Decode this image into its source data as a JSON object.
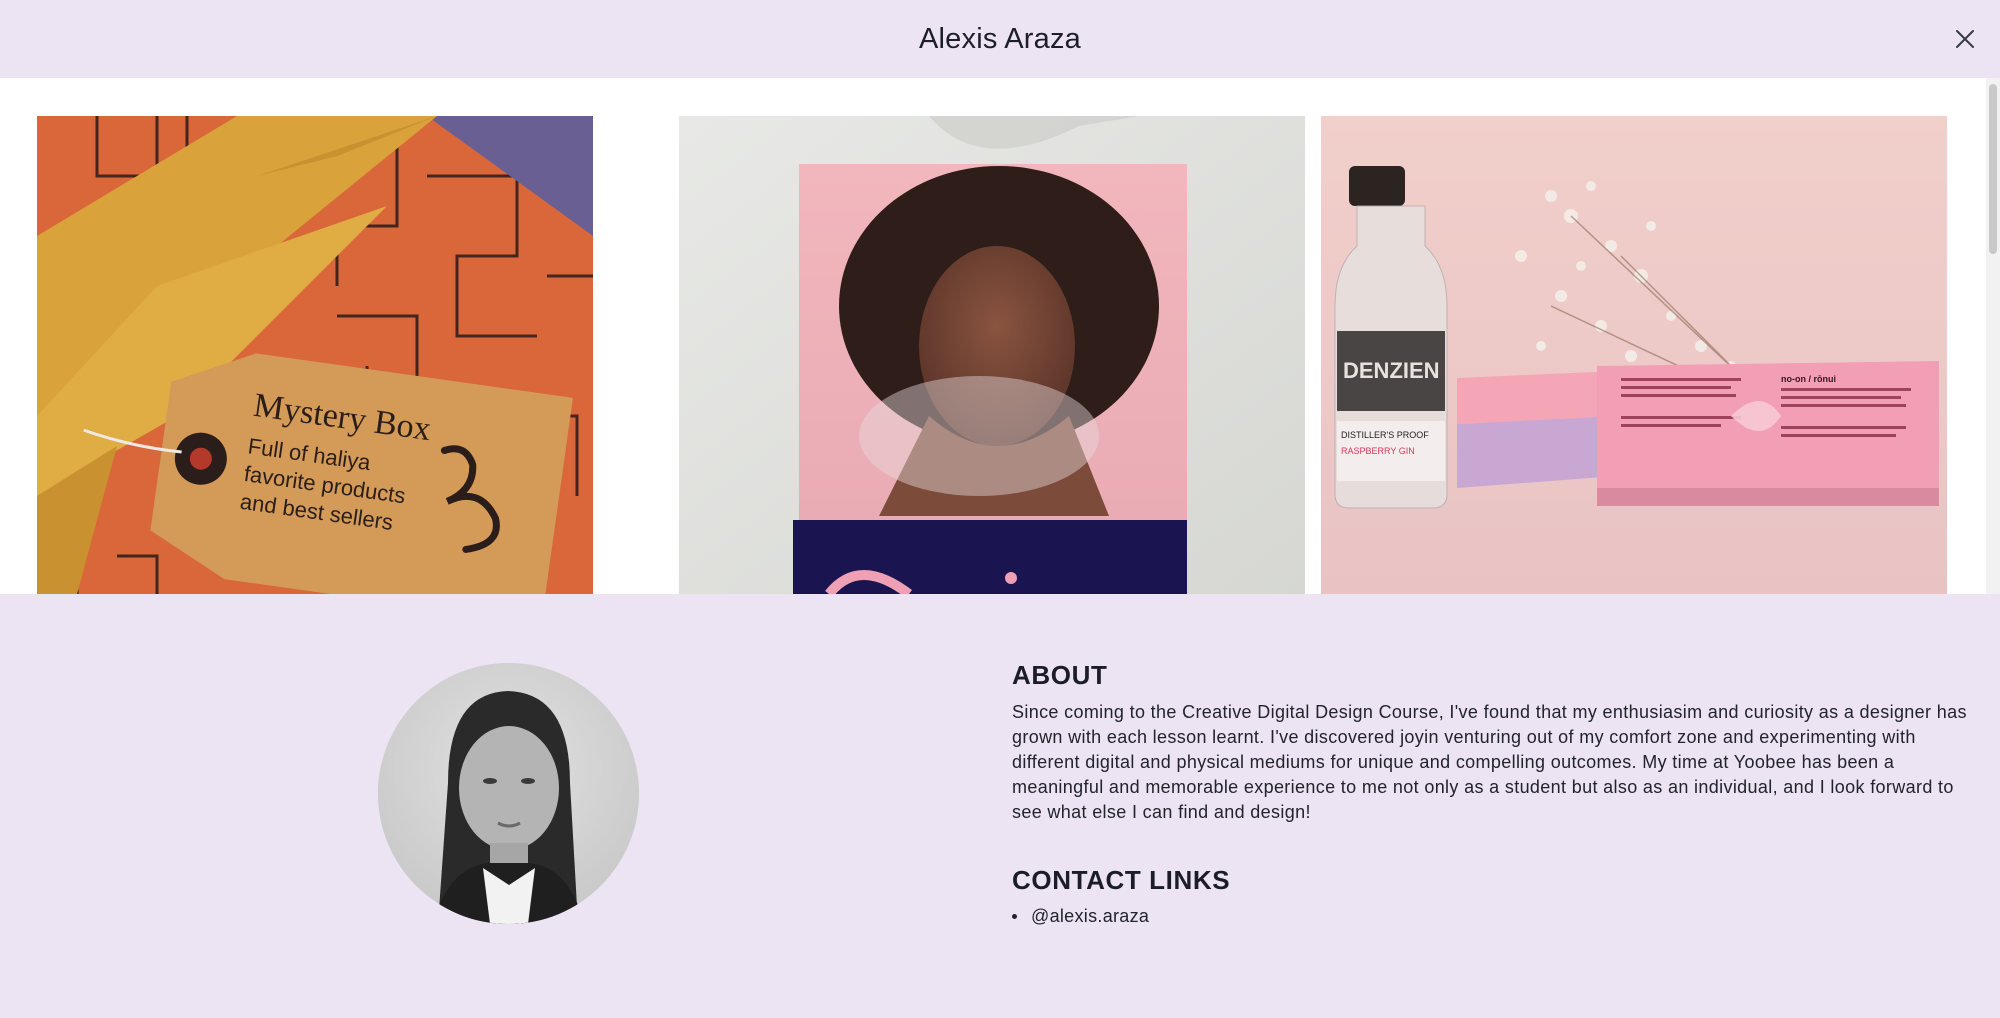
{
  "header": {
    "title": "Alexis Araza",
    "close_icon": "close-icon"
  },
  "gallery": {
    "tiles": [
      {
        "name": "mystery-box-tag",
        "tag_title": "Mystery Box",
        "tag_line_1": "Full of haliya",
        "tag_line_2": "favorite products",
        "tag_line_3": "and best sellers",
        "colors": {
          "background": "#d9673a",
          "ribbon": "#d9a23b",
          "tag": "#d39a58",
          "corner": "#6a5f92"
        }
      },
      {
        "name": "portrait-poster",
        "colors": {
          "background": "#dedfdc",
          "poster": "#f0b9c0",
          "band": "#1a1550"
        }
      },
      {
        "name": "denzien-bottle-packaging",
        "bottle_label": "DENZIEN",
        "bottle_sub": "DISTILLER'S PROOF",
        "bottle_flavor": "RASPBERRY GIN",
        "box_heading": "no-on / rōnui",
        "colors": {
          "background": "#efc9c6",
          "box": "#f4a6b7"
        }
      }
    ]
  },
  "profile": {
    "avatar_alt": "Alexis Araza portrait",
    "about_heading": "ABOUT",
    "about_text": "Since coming to the Creative Digital Design Course, I've found that my enthusiasim and curiosity as a designer has grown with each lesson learnt. I've discovered joyin venturing out of my comfort zone and experimenting with different digital and physical mediums for unique and compelling outcomes. My time at Yoobee has been a meaningful and memorable experience to me not only as a student but also as an individual, and I look forward to see what else I can find and design!",
    "contact_heading": "CONTACT LINKS",
    "contacts": [
      {
        "label": "@alexis.araza"
      }
    ]
  }
}
